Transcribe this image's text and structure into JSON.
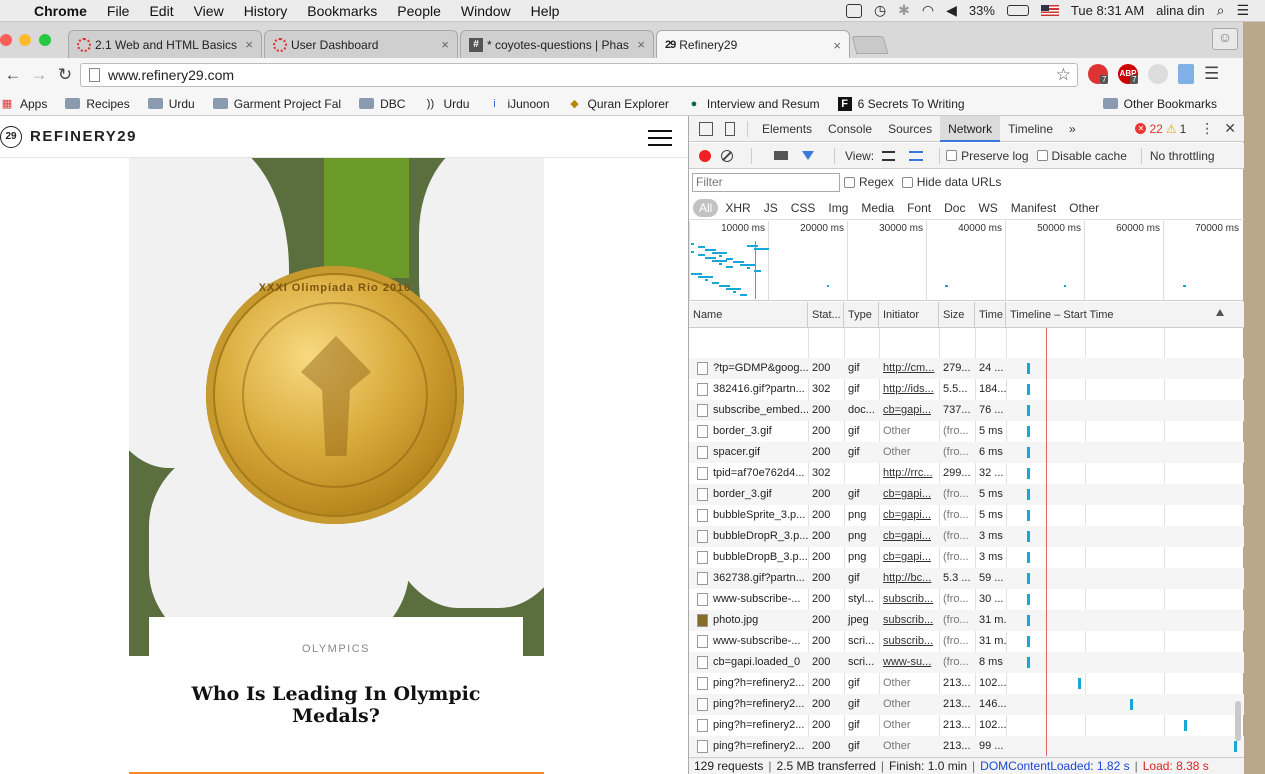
{
  "menubar": {
    "app": "Chrome",
    "items": [
      "File",
      "Edit",
      "View",
      "History",
      "Bookmarks",
      "People",
      "Window",
      "Help"
    ],
    "battery": "33%",
    "clock": "Tue 8:31 AM",
    "user": "alina din"
  },
  "tabs": [
    {
      "title": "2.1 Web and HTML Basics",
      "close": "×"
    },
    {
      "title": "User Dashboard",
      "close": "×"
    },
    {
      "title": "* coyotes-questions | Phas",
      "close": "×"
    },
    {
      "title": "Refinery29",
      "close": "×"
    }
  ],
  "omnibox": {
    "url": "www.refinery29.com"
  },
  "extensions": {
    "ext1_badge": "7",
    "abp_label": "ABP",
    "abp_badge": "7"
  },
  "bookmarks": {
    "items": [
      {
        "label": "Apps"
      },
      {
        "label": "Recipes"
      },
      {
        "label": "Urdu"
      },
      {
        "label": "Garment Project Fal"
      },
      {
        "label": "DBC"
      },
      {
        "label": "Urdu"
      },
      {
        "label": "iJunoon"
      },
      {
        "label": "Quran Explorer"
      },
      {
        "label": "Interview and Resum"
      },
      {
        "label": "6 Secrets To Writing"
      }
    ],
    "other": "Other Bookmarks"
  },
  "site": {
    "logo_mark": "29",
    "logo_text": "REFINERY29",
    "medal_inscription": "XXXI Olimpíada Rio 2016",
    "article_category": "OLYMPICS",
    "article_title": "Who Is Leading In Olympic Medals?"
  },
  "devtools": {
    "tabs": [
      "Elements",
      "Console",
      "Sources",
      "Network",
      "Timeline"
    ],
    "more": "»",
    "active_tab": "Network",
    "errors": "22",
    "warnings": "1",
    "view_label": "View:",
    "preserve_log": "Preserve log",
    "disable_cache": "Disable cache",
    "throttling": "No throttling",
    "filter_placeholder": "Filter",
    "regex": "Regex",
    "hide_data_urls": "Hide data URLs",
    "types": [
      "All",
      "XHR",
      "JS",
      "CSS",
      "Img",
      "Media",
      "Font",
      "Doc",
      "WS",
      "Manifest",
      "Other"
    ],
    "overview_ticks": [
      "10000 ms",
      "20000 ms",
      "30000 ms",
      "40000 ms",
      "50000 ms",
      "60000 ms",
      "70000 ms"
    ],
    "columns": [
      "Name",
      "Stat...",
      "Type",
      "Initiator",
      "Size",
      "Time",
      "Timeline – Start Time"
    ],
    "rows": [
      {
        "name": "?tp=GDMP&goog...",
        "status": "200",
        "type": "gif",
        "initiator": "http://cm...",
        "size": "279...",
        "time": "24 ...",
        "link": true,
        "icon": "doc",
        "start": 0.076
      },
      {
        "name": "382416.gif?partn...",
        "status": "302",
        "type": "gif",
        "initiator": "http://ids...",
        "size": "5.5...",
        "time": "184...",
        "link": true,
        "icon": "doc",
        "start": 0.076
      },
      {
        "name": "subscribe_embed...",
        "status": "200",
        "type": "doc...",
        "initiator": "cb=gapi...",
        "size": "737...",
        "time": "76 ...",
        "link": true,
        "icon": "doc",
        "start": 0.076
      },
      {
        "name": "border_3.gif",
        "status": "200",
        "type": "gif",
        "initiator": "Other",
        "size": "(fro...",
        "time": "5 ms",
        "link": false,
        "icon": "doc",
        "start": 0.076
      },
      {
        "name": "spacer.gif",
        "status": "200",
        "type": "gif",
        "initiator": "Other",
        "size": "(fro...",
        "time": "6 ms",
        "link": false,
        "icon": "doc",
        "start": 0.076
      },
      {
        "name": "tpid=af70e762d4...",
        "status": "302",
        "type": "",
        "initiator": "http://rrc...",
        "size": "299...",
        "time": "32 ...",
        "link": true,
        "icon": "doc",
        "start": 0.076
      },
      {
        "name": "border_3.gif",
        "status": "200",
        "type": "gif",
        "initiator": "cb=gapi...",
        "size": "(fro...",
        "time": "5 ms",
        "link": true,
        "icon": "doc",
        "start": 0.076
      },
      {
        "name": "bubbleSprite_3.p...",
        "status": "200",
        "type": "png",
        "initiator": "cb=gapi...",
        "size": "(fro...",
        "time": "5 ms",
        "link": true,
        "icon": "doc",
        "start": 0.076
      },
      {
        "name": "bubbleDropR_3.p...",
        "status": "200",
        "type": "png",
        "initiator": "cb=gapi...",
        "size": "(fro...",
        "time": "3 ms",
        "link": true,
        "icon": "doc",
        "start": 0.076
      },
      {
        "name": "bubbleDropB_3.p...",
        "status": "200",
        "type": "png",
        "initiator": "cb=gapi...",
        "size": "(fro...",
        "time": "3 ms",
        "link": true,
        "icon": "doc",
        "start": 0.076
      },
      {
        "name": "362738.gif?partn...",
        "status": "200",
        "type": "gif",
        "initiator": "http://bc...",
        "size": "5.3 ...",
        "time": "59 ...",
        "link": true,
        "icon": "doc",
        "start": 0.076
      },
      {
        "name": "www-subscribe-...",
        "status": "200",
        "type": "styl...",
        "initiator": "subscrib...",
        "size": "(fro...",
        "time": "30 ...",
        "link": true,
        "icon": "doc",
        "start": 0.076
      },
      {
        "name": "photo.jpg",
        "status": "200",
        "type": "jpeg",
        "initiator": "subscrib...",
        "size": "(fro...",
        "time": "31 m...",
        "link": true,
        "icon": "img",
        "start": 0.076
      },
      {
        "name": "www-subscribe-...",
        "status": "200",
        "type": "scri...",
        "initiator": "subscrib...",
        "size": "(fro...",
        "time": "31 m...",
        "link": true,
        "icon": "doc",
        "start": 0.076
      },
      {
        "name": "cb=gapi.loaded_0",
        "status": "200",
        "type": "scri...",
        "initiator": "www-su...",
        "size": "(fro...",
        "time": "8 ms",
        "link": true,
        "icon": "doc",
        "start": 0.076
      },
      {
        "name": "ping?h=refinery2...",
        "status": "200",
        "type": "gif",
        "initiator": "Other",
        "size": "213...",
        "time": "102...",
        "link": false,
        "icon": "doc",
        "start": 0.3
      },
      {
        "name": "ping?h=refinery2...",
        "status": "200",
        "type": "gif",
        "initiator": "Other",
        "size": "213...",
        "time": "146...",
        "link": false,
        "icon": "doc",
        "start": 0.53
      },
      {
        "name": "ping?h=refinery2...",
        "status": "200",
        "type": "gif",
        "initiator": "Other",
        "size": "213...",
        "time": "102...",
        "link": false,
        "icon": "doc",
        "start": 0.77
      },
      {
        "name": "ping?h=refinery2...",
        "status": "200",
        "type": "gif",
        "initiator": "Other",
        "size": "213...",
        "time": "99 ...",
        "link": false,
        "icon": "doc",
        "start": 0.99
      }
    ],
    "status_bar": {
      "requests": "129 requests",
      "transferred": "2.5 MB transferred",
      "finish": "Finish: 1.0 min",
      "dcl": "DOMContentLoaded: 1.82 s",
      "load": "Load: 8.38 s"
    },
    "colors": {
      "accent": "#3879d9",
      "waterfall": "#17a8d8",
      "load_line": "#e06666",
      "dcl": "#1a47d6",
      "load": "#d22222"
    }
  }
}
